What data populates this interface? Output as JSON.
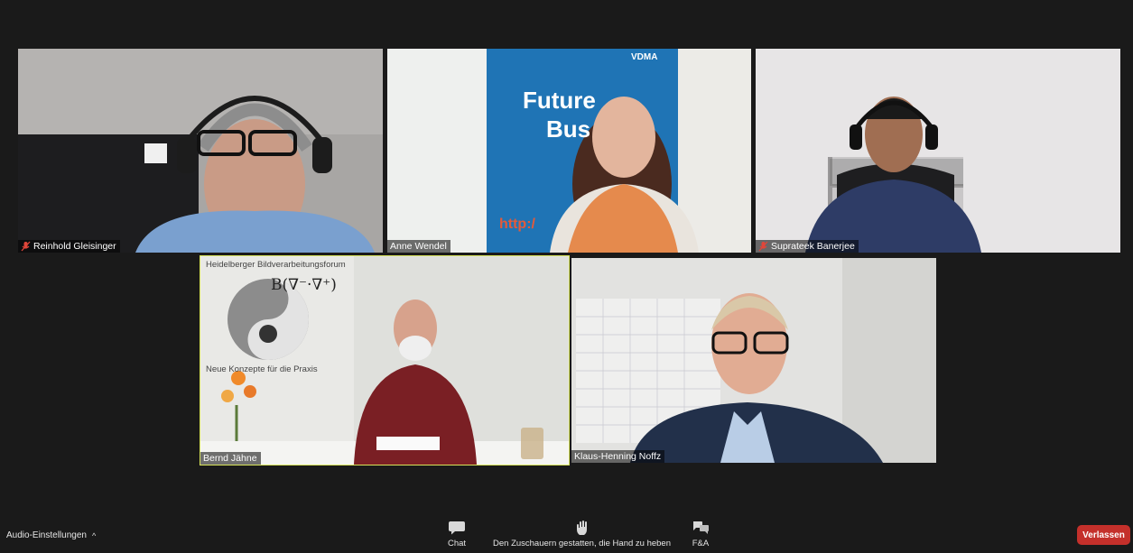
{
  "participants": [
    {
      "name": "Reinhold Gleisinger",
      "muted": true
    },
    {
      "name": "Anne Wendel",
      "muted": false,
      "background_text": [
        "Future",
        "Bus",
        "http:/"
      ],
      "banner_logo": "VDMA"
    },
    {
      "name": "Suprateek Banerjee",
      "muted": true
    },
    {
      "name": "Bernd Jähne",
      "muted": false,
      "active_speaker": true,
      "poster_text": [
        "Heidelberger Bildverarbeitungsforum",
        "Neue Konzepte für die Praxis",
        "B(∇⁻·∇⁺)"
      ]
    },
    {
      "name": "Klaus-Henning Noffz",
      "muted": false
    }
  ],
  "toolbar": {
    "audio_settings": "Audio-Einstellungen",
    "chat": "Chat",
    "raise_hand": "Den Zuschauern gestatten, die Hand zu heben",
    "qa": "F&A",
    "leave": "Verlassen"
  },
  "colors": {
    "background": "#1a1a1a",
    "active_speaker_border": "#d7e35a",
    "leave_button": "#c4302b",
    "muted_icon": "#e0463a"
  }
}
